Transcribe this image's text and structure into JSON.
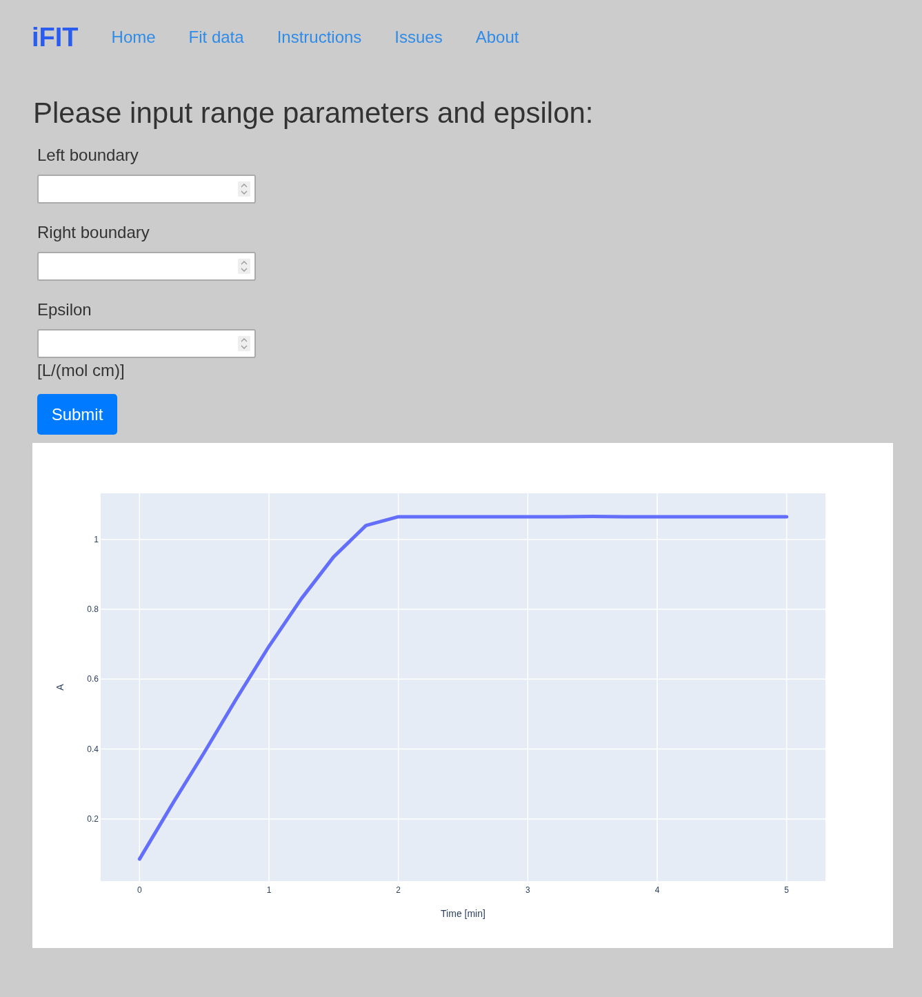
{
  "nav": {
    "brand": "iFIT",
    "links": [
      {
        "label": "Home"
      },
      {
        "label": "Fit data"
      },
      {
        "label": "Instructions"
      },
      {
        "label": "Issues"
      },
      {
        "label": "About"
      }
    ]
  },
  "heading": "Please input range parameters and epsilon:",
  "fields": [
    {
      "label": "Left boundary"
    },
    {
      "label": "Right boundary"
    },
    {
      "label": "Epsilon",
      "unit": "[L/(mol cm)]"
    }
  ],
  "submit": "Submit",
  "chart": {
    "chart_data": {
      "type": "line",
      "grid": true,
      "xlabel": "Time [min]",
      "ylabel": "A",
      "xlim": [
        -0.3,
        5.3
      ],
      "ylim": [
        0.022,
        1.132
      ],
      "xticks": [
        0,
        1,
        2,
        3,
        4,
        5
      ],
      "yticks": [
        0.2,
        0.4,
        0.6,
        0.8,
        1
      ],
      "x": [
        0,
        0.25,
        0.5,
        0.75,
        1,
        1.25,
        1.5,
        1.75,
        2,
        2.25,
        2.5,
        2.75,
        3,
        3.25,
        3.5,
        3.75,
        4,
        4.25,
        4.5,
        4.75,
        5
      ],
      "series": [
        {
          "color": "#636efa",
          "values": [
            0.085,
            0.24,
            0.39,
            0.545,
            0.694,
            0.83,
            0.95,
            1.04,
            1.065,
            1.065,
            1.065,
            1.065,
            1.065,
            1.065,
            1.066,
            1.065,
            1.065,
            1.065,
            1.065,
            1.065,
            1.065
          ]
        }
      ]
    }
  }
}
